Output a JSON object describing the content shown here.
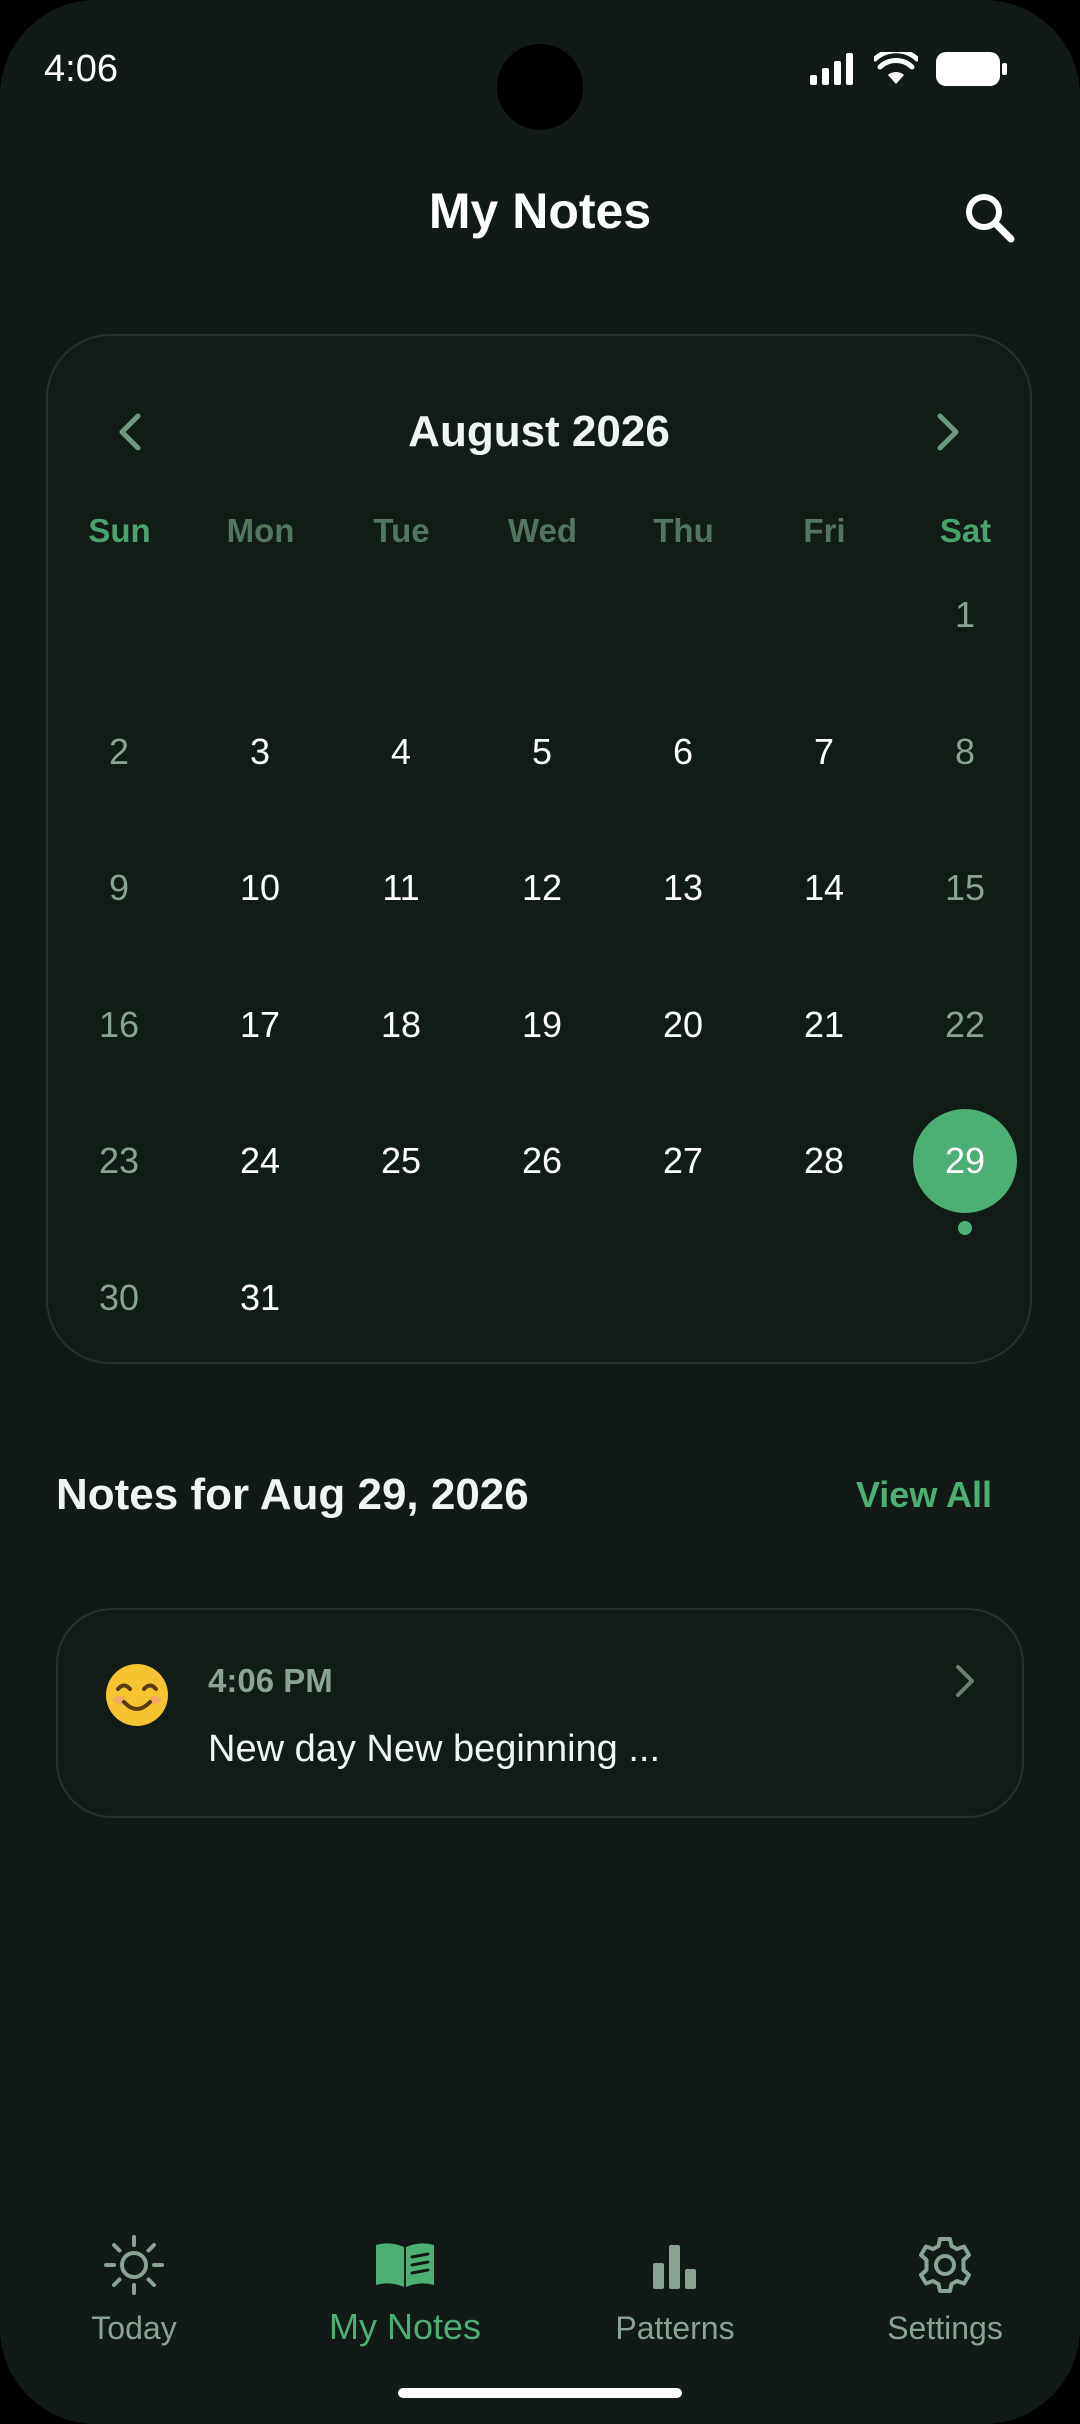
{
  "status_bar": {
    "time": "4:06"
  },
  "header": {
    "title": "My Notes"
  },
  "calendar": {
    "month_label": "August 2026",
    "weekdays": [
      "Sun",
      "Mon",
      "Tue",
      "Wed",
      "Thu",
      "Fri",
      "Sat"
    ],
    "first_weekday_index": 6,
    "days_in_month": 31,
    "selected_day": 29,
    "days_with_notes": [
      29
    ],
    "accent_color": "#4caf73"
  },
  "notes_section": {
    "title": "Notes for Aug 29, 2026",
    "view_all_label": "View All",
    "notes": [
      {
        "emoji": "smiling-face-icon",
        "time": "4:06 PM",
        "text": "New day New beginning ..."
      }
    ]
  },
  "bottom_nav": {
    "items": [
      {
        "label": "Today",
        "icon": "sun-icon"
      },
      {
        "label": "My Notes",
        "icon": "book-icon",
        "active": true
      },
      {
        "label": "Patterns",
        "icon": "bar-chart-icon"
      },
      {
        "label": "Settings",
        "icon": "gear-icon"
      }
    ]
  }
}
